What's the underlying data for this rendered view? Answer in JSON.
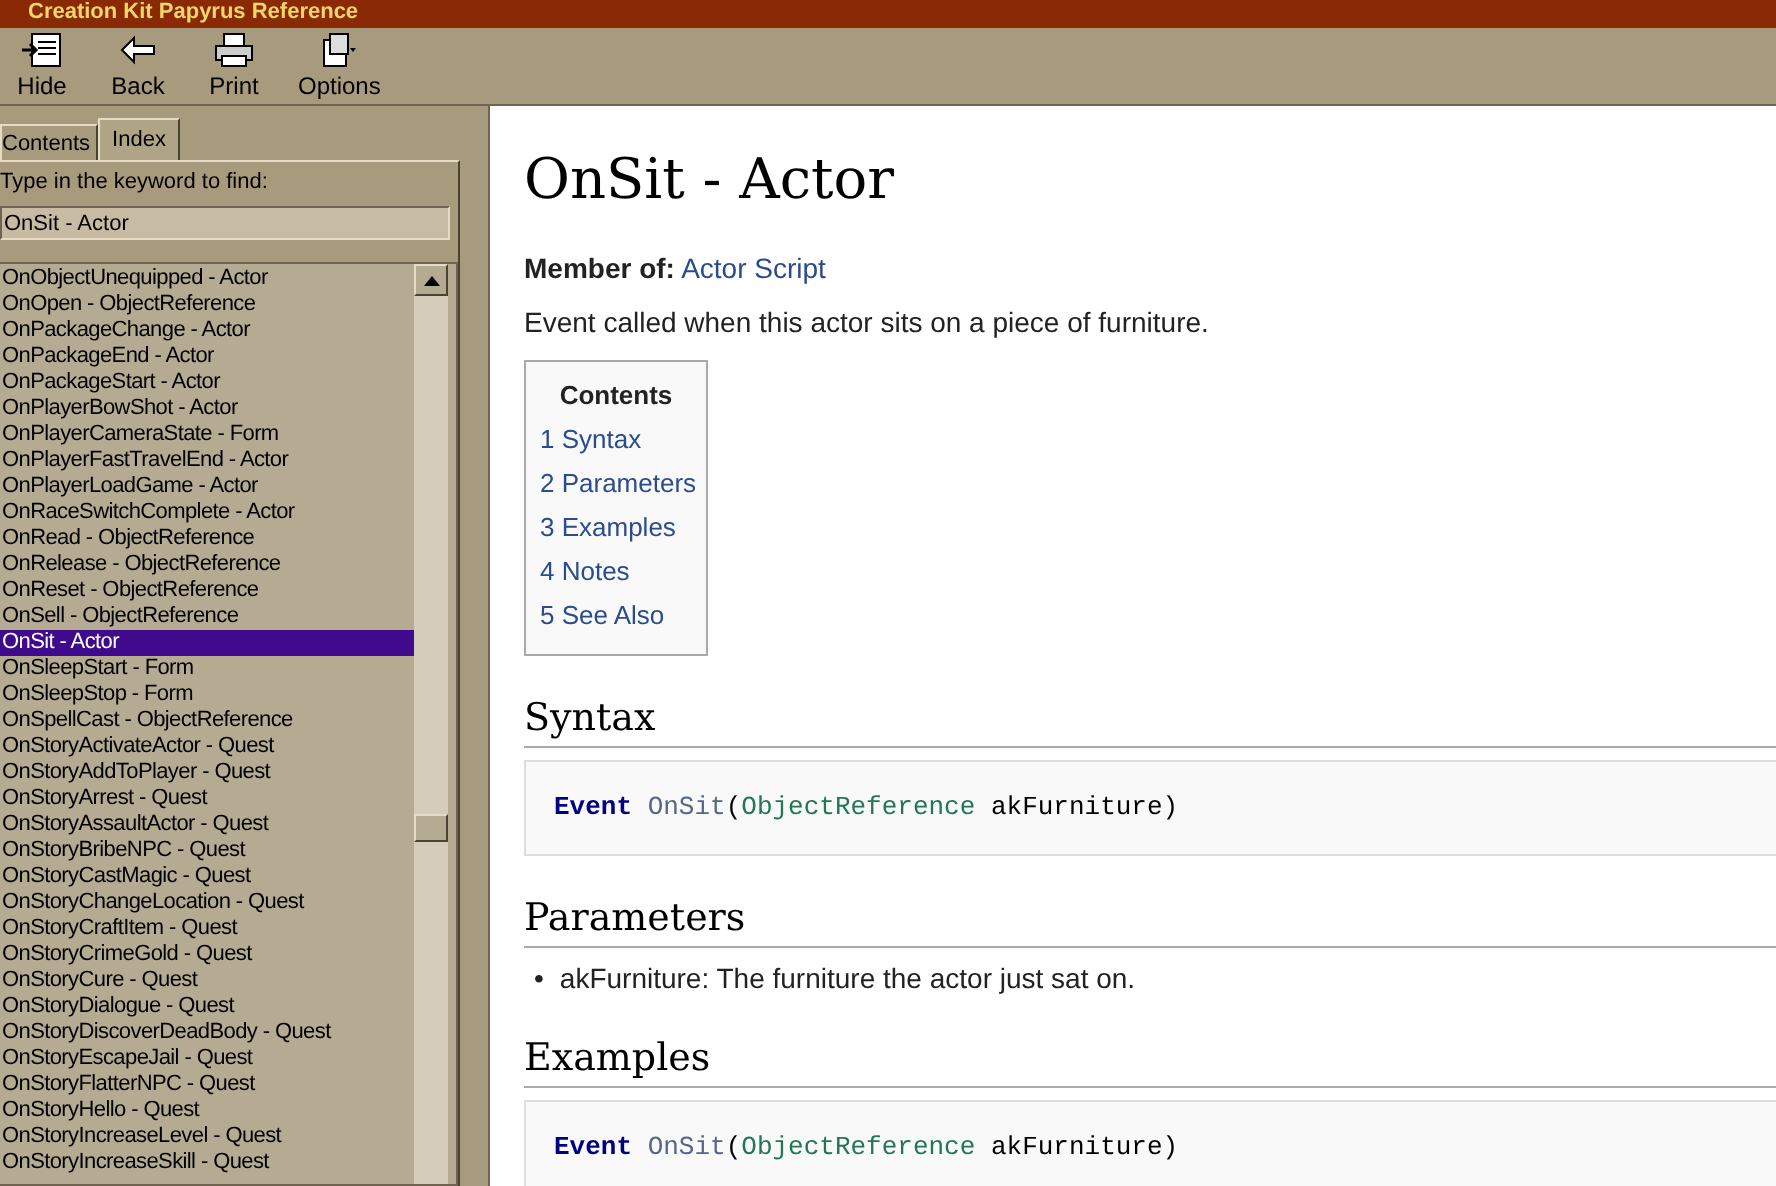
{
  "window": {
    "title": "Creation Kit Papyrus Reference"
  },
  "toolbar": [
    {
      "kind": "hide",
      "label": "Hide"
    },
    {
      "kind": "back",
      "label": "Back"
    },
    {
      "kind": "print",
      "label": "Print"
    },
    {
      "kind": "options",
      "label": "Options"
    }
  ],
  "tabs": [
    {
      "label": "Contents",
      "selected": false
    },
    {
      "label": "Index",
      "selected": true
    }
  ],
  "index": {
    "prompt": "Type in the keyword to find:",
    "value": "OnSit - Actor",
    "items": [
      {
        "label": "OnObjectUnequipped - Actor",
        "selected": false
      },
      {
        "label": "OnOpen - ObjectReference",
        "selected": false
      },
      {
        "label": "OnPackageChange - Actor",
        "selected": false
      },
      {
        "label": "OnPackageEnd - Actor",
        "selected": false
      },
      {
        "label": "OnPackageStart - Actor",
        "selected": false
      },
      {
        "label": "OnPlayerBowShot - Actor",
        "selected": false
      },
      {
        "label": "OnPlayerCameraState - Form",
        "selected": false
      },
      {
        "label": "OnPlayerFastTravelEnd - Actor",
        "selected": false
      },
      {
        "label": "OnPlayerLoadGame - Actor",
        "selected": false
      },
      {
        "label": "OnRaceSwitchComplete - Actor",
        "selected": false
      },
      {
        "label": "OnRead - ObjectReference",
        "selected": false
      },
      {
        "label": "OnRelease - ObjectReference",
        "selected": false
      },
      {
        "label": "OnReset - ObjectReference",
        "selected": false
      },
      {
        "label": "OnSell - ObjectReference",
        "selected": false
      },
      {
        "label": "OnSit - Actor",
        "selected": true
      },
      {
        "label": "OnSleepStart - Form",
        "selected": false
      },
      {
        "label": "OnSleepStop - Form",
        "selected": false
      },
      {
        "label": "OnSpellCast - ObjectReference",
        "selected": false
      },
      {
        "label": "OnStoryActivateActor - Quest",
        "selected": false
      },
      {
        "label": "OnStoryAddToPlayer - Quest",
        "selected": false
      },
      {
        "label": "OnStoryArrest - Quest",
        "selected": false
      },
      {
        "label": "OnStoryAssaultActor - Quest",
        "selected": false
      },
      {
        "label": "OnStoryBribeNPC - Quest",
        "selected": false
      },
      {
        "label": "OnStoryCastMagic - Quest",
        "selected": false
      },
      {
        "label": "OnStoryChangeLocation - Quest",
        "selected": false
      },
      {
        "label": "OnStoryCraftItem - Quest",
        "selected": false
      },
      {
        "label": "OnStoryCrimeGold - Quest",
        "selected": false
      },
      {
        "label": "OnStoryCure - Quest",
        "selected": false
      },
      {
        "label": "OnStoryDialogue - Quest",
        "selected": false
      },
      {
        "label": "OnStoryDiscoverDeadBody - Quest",
        "selected": false
      },
      {
        "label": "OnStoryEscapeJail - Quest",
        "selected": false
      },
      {
        "label": "OnStoryFlatterNPC - Quest",
        "selected": false
      },
      {
        "label": "OnStoryHello - Quest",
        "selected": false
      },
      {
        "label": "OnStoryIncreaseLevel - Quest",
        "selected": false
      },
      {
        "label": "OnStoryIncreaseSkill - Quest",
        "selected": false
      }
    ]
  },
  "page": {
    "title": "OnSit - Actor",
    "member_label": "Member of:",
    "member_link": "Actor Script",
    "description": "Event called when this actor sits on a piece of furniture.",
    "toc": {
      "title": "Contents",
      "items": [
        "1 Syntax",
        "2 Parameters",
        "3 Examples",
        "4 Notes",
        "5 See Also"
      ]
    },
    "sections": [
      {
        "heading": "Syntax",
        "kind": "code",
        "code": [
          {
            "kind": "keyword",
            "text": "Event"
          },
          {
            "kind": "function",
            "text": "OnSit"
          },
          {
            "kind": "plain",
            "text": "("
          },
          {
            "kind": "type",
            "text": "ObjectReference"
          },
          {
            "kind": "plain",
            "text": " akFurniture)"
          }
        ]
      },
      {
        "heading": "Parameters",
        "kind": "list",
        "bullet": "•",
        "items": [
          "akFurniture: The furniture the actor just sat on."
        ]
      },
      {
        "heading": "Examples",
        "kind": "code",
        "code": [
          {
            "kind": "keyword",
            "text": "Event"
          },
          {
            "kind": "function",
            "text": "OnSit"
          },
          {
            "kind": "plain",
            "text": "("
          },
          {
            "kind": "type",
            "text": "ObjectReference"
          },
          {
            "kind": "plain",
            "text": " akFurniture)"
          }
        ]
      }
    ]
  }
}
